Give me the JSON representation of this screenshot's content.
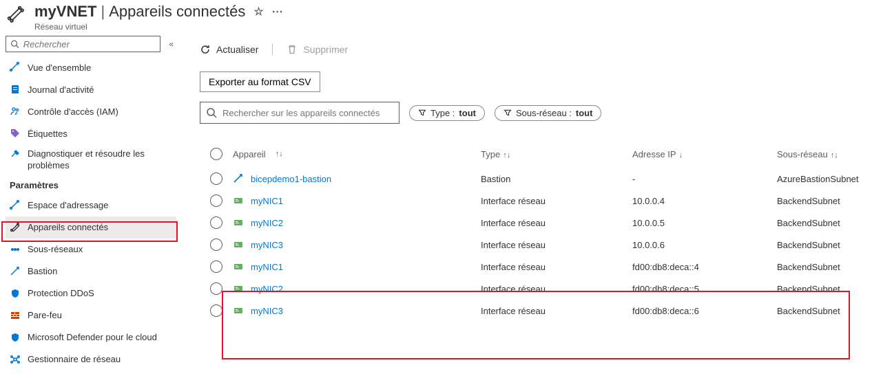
{
  "header": {
    "resource_name": "myVNET",
    "page_title": "Appareils connectés",
    "subtitle": "Réseau virtuel"
  },
  "sidebar": {
    "search_placeholder": "Rechercher",
    "items_top": [
      {
        "label": "Vue d'ensemble",
        "icon": "overview"
      },
      {
        "label": "Journal d'activité",
        "icon": "activity-log"
      },
      {
        "label": "Contrôle d'accès (IAM)",
        "icon": "iam"
      },
      {
        "label": "Étiquettes",
        "icon": "tags"
      },
      {
        "label": "Diagnostiquer et résoudre les problèmes",
        "icon": "diagnose",
        "wrap": true
      }
    ],
    "section_settings": "Paramètres",
    "items_settings": [
      {
        "label": "Espace d'adressage",
        "icon": "address-space"
      },
      {
        "label": "Appareils connectés",
        "icon": "connected-devices",
        "selected": true
      },
      {
        "label": "Sous-réseaux",
        "icon": "subnets"
      },
      {
        "label": "Bastion",
        "icon": "bastion"
      },
      {
        "label": "Protection DDoS",
        "icon": "ddos"
      },
      {
        "label": "Pare-feu",
        "icon": "firewall"
      },
      {
        "label": "Microsoft Defender pour le cloud",
        "icon": "defender"
      },
      {
        "label": "Gestionnaire de réseau",
        "icon": "network-manager"
      }
    ]
  },
  "toolbar": {
    "refresh_label": "Actualiser",
    "delete_label": "Supprimer",
    "export_csv_label": "Exporter au format CSV",
    "device_search_placeholder": "Rechercher sur les appareils connectés",
    "pill_type_label": "Type : ",
    "pill_type_value": "tout",
    "pill_subnet_label": "Sous-réseau : ",
    "pill_subnet_value": "tout"
  },
  "table": {
    "headers": {
      "device": "Appareil",
      "type": "Type",
      "ip": "Adresse IP",
      "subnet": "Sous-réseau"
    },
    "rows": [
      {
        "device": "bicepdemo1-bastion",
        "icon": "bastion",
        "type": "Bastion",
        "ip": "-",
        "subnet": "AzureBastionSubnet"
      },
      {
        "device": "myNIC1",
        "icon": "nic",
        "type": "Interface réseau",
        "ip": "10.0.0.4",
        "subnet": "BackendSubnet"
      },
      {
        "device": "myNIC2",
        "icon": "nic",
        "type": "Interface réseau",
        "ip": "10.0.0.5",
        "subnet": "BackendSubnet"
      },
      {
        "device": "myNIC3",
        "icon": "nic",
        "type": "Interface réseau",
        "ip": "10.0.0.6",
        "subnet": "BackendSubnet"
      },
      {
        "device": "myNIC1",
        "icon": "nic",
        "type": "Interface réseau",
        "ip": "fd00:db8:deca::4",
        "subnet": "BackendSubnet"
      },
      {
        "device": "myNIC2",
        "icon": "nic",
        "type": "Interface réseau",
        "ip": "fd00:db8:deca::5",
        "subnet": "BackendSubnet"
      },
      {
        "device": "myNIC3",
        "icon": "nic",
        "type": "Interface réseau",
        "ip": "fd00:db8:deca::6",
        "subnet": "BackendSubnet"
      }
    ]
  }
}
